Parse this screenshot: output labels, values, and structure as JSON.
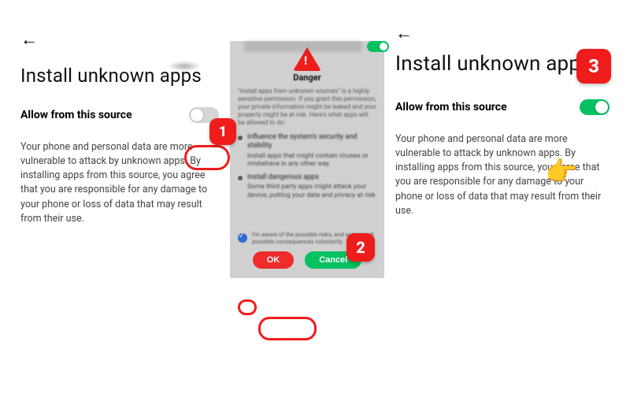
{
  "steps": {
    "one": "1",
    "two": "2",
    "three": "3"
  },
  "left": {
    "back_glyph": "←",
    "title": "Install unknown apps",
    "allow_label": "Allow from this source",
    "toggle_on": false,
    "description": "Your phone and personal data are more vulnerable to attack by unknown apps. By installing apps from this source, you agree that you are responsible for any damage to your phone or loss of data that may result from their use."
  },
  "dialog": {
    "danger_label": "Danger",
    "intro": "\"Install apps from unknown sources\" is a highly sensitive permission. If you grant this permission, your private information might be leaked and your property might be at risk. Here's what apps will be allowed to do:",
    "bullets": [
      {
        "head": "Influence the system's security and stability",
        "sub": "Install apps that might contain viruses or misbehave in any other way"
      },
      {
        "head": "Install dangerous apps",
        "sub": "Some third party apps might attack your device, putting your data and privacy at risk"
      }
    ],
    "consent": "I'm aware of the possible risks, and assume all possible consequences voluntarily.",
    "ok_label": "OK",
    "cancel_label": "Cancel"
  },
  "right": {
    "back_glyph": "←",
    "title": "Install unknown apps",
    "allow_label": "Allow from this source",
    "toggle_on": true,
    "hand_glyph": "👉",
    "description": "Your phone and personal data are more vulnerable to attack by unknown apps. By installing apps from this source, you agree that you are responsible for any damage to your phone or loss of data that may result from their use."
  },
  "colors": {
    "accent_red": "#ef1c1c",
    "accent_green": "#06c160"
  }
}
